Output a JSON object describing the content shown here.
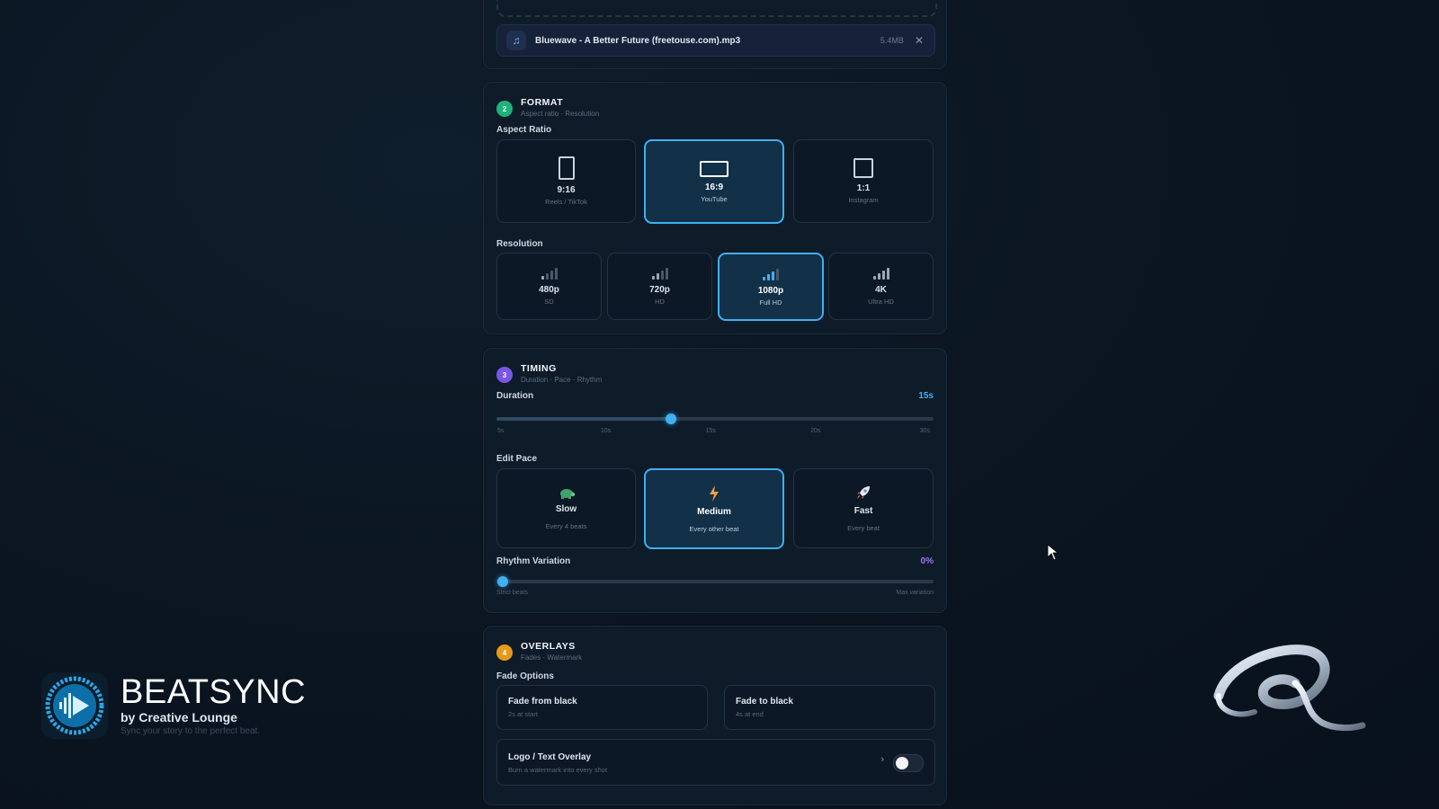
{
  "upload": {
    "file_name": "Bluewave - A Better Future (freetouse.com).mp3",
    "file_size": "5.4MB",
    "file_icon": "music-note-icon",
    "remove_icon": "close-icon"
  },
  "format": {
    "step": "2",
    "title": "FORMAT",
    "subtitle": "Aspect ratio · Resolution",
    "aspect_label": "Aspect Ratio",
    "aspect_options": [
      {
        "ratio": "9:16",
        "desc": "Reels / TikTok",
        "selected": false
      },
      {
        "ratio": "16:9",
        "desc": "YouTube",
        "selected": true
      },
      {
        "ratio": "1:1",
        "desc": "Instagram",
        "selected": false
      }
    ],
    "resolution_label": "Resolution",
    "resolution_options": [
      {
        "name": "480p",
        "desc": "SD",
        "signal": 1,
        "selected": false
      },
      {
        "name": "720p",
        "desc": "HD",
        "signal": 2,
        "selected": false
      },
      {
        "name": "1080p",
        "desc": "Full HD",
        "signal": 3,
        "selected": true
      },
      {
        "name": "4K",
        "desc": "Ultra HD",
        "signal": 4,
        "selected": false
      }
    ]
  },
  "timing": {
    "step": "3",
    "title": "TIMING",
    "subtitle": "Duration · Pace · Rhythm",
    "duration_label": "Duration",
    "duration_value": "15s",
    "duration_ticks": [
      "5s",
      "10s",
      "15s",
      "20s",
      "30s"
    ],
    "duration_fraction": 0.4,
    "pace_label": "Edit Pace",
    "pace_options": [
      {
        "name": "Slow",
        "desc": "Every 4 beats",
        "icon": "turtle-icon",
        "selected": false
      },
      {
        "name": "Medium",
        "desc": "Every other beat",
        "icon": "lightning-icon",
        "selected": true
      },
      {
        "name": "Fast",
        "desc": "Every beat",
        "icon": "rocket-icon",
        "selected": false
      }
    ],
    "rhythm_label": "Rhythm Variation",
    "rhythm_value": "0%",
    "rhythm_fraction": 0.0,
    "rhythm_min_label": "Strict beats",
    "rhythm_max_label": "Max variation"
  },
  "overlays": {
    "step": "4",
    "title": "OVERLAYS",
    "subtitle": "Fades · Watermark",
    "fade_label": "Fade Options",
    "fade_in": {
      "title": "Fade from black",
      "desc": "2s at start"
    },
    "fade_out": {
      "title": "Fade to black",
      "desc": "4s at end"
    },
    "logo_title": "Logo / Text Overlay",
    "logo_desc": "Burn a watermark into every shot",
    "logo_enabled": false
  },
  "brand": {
    "name": "BEATSYNC",
    "by": "by Creative Lounge",
    "tagline": "Sync your story to the perfect beat."
  },
  "colors": {
    "accent": "#3fb0f0",
    "green": "#1db37a",
    "purple": "#7b55e6",
    "amber": "#e59a1b",
    "rhythm_value": "#9b7bf0"
  }
}
